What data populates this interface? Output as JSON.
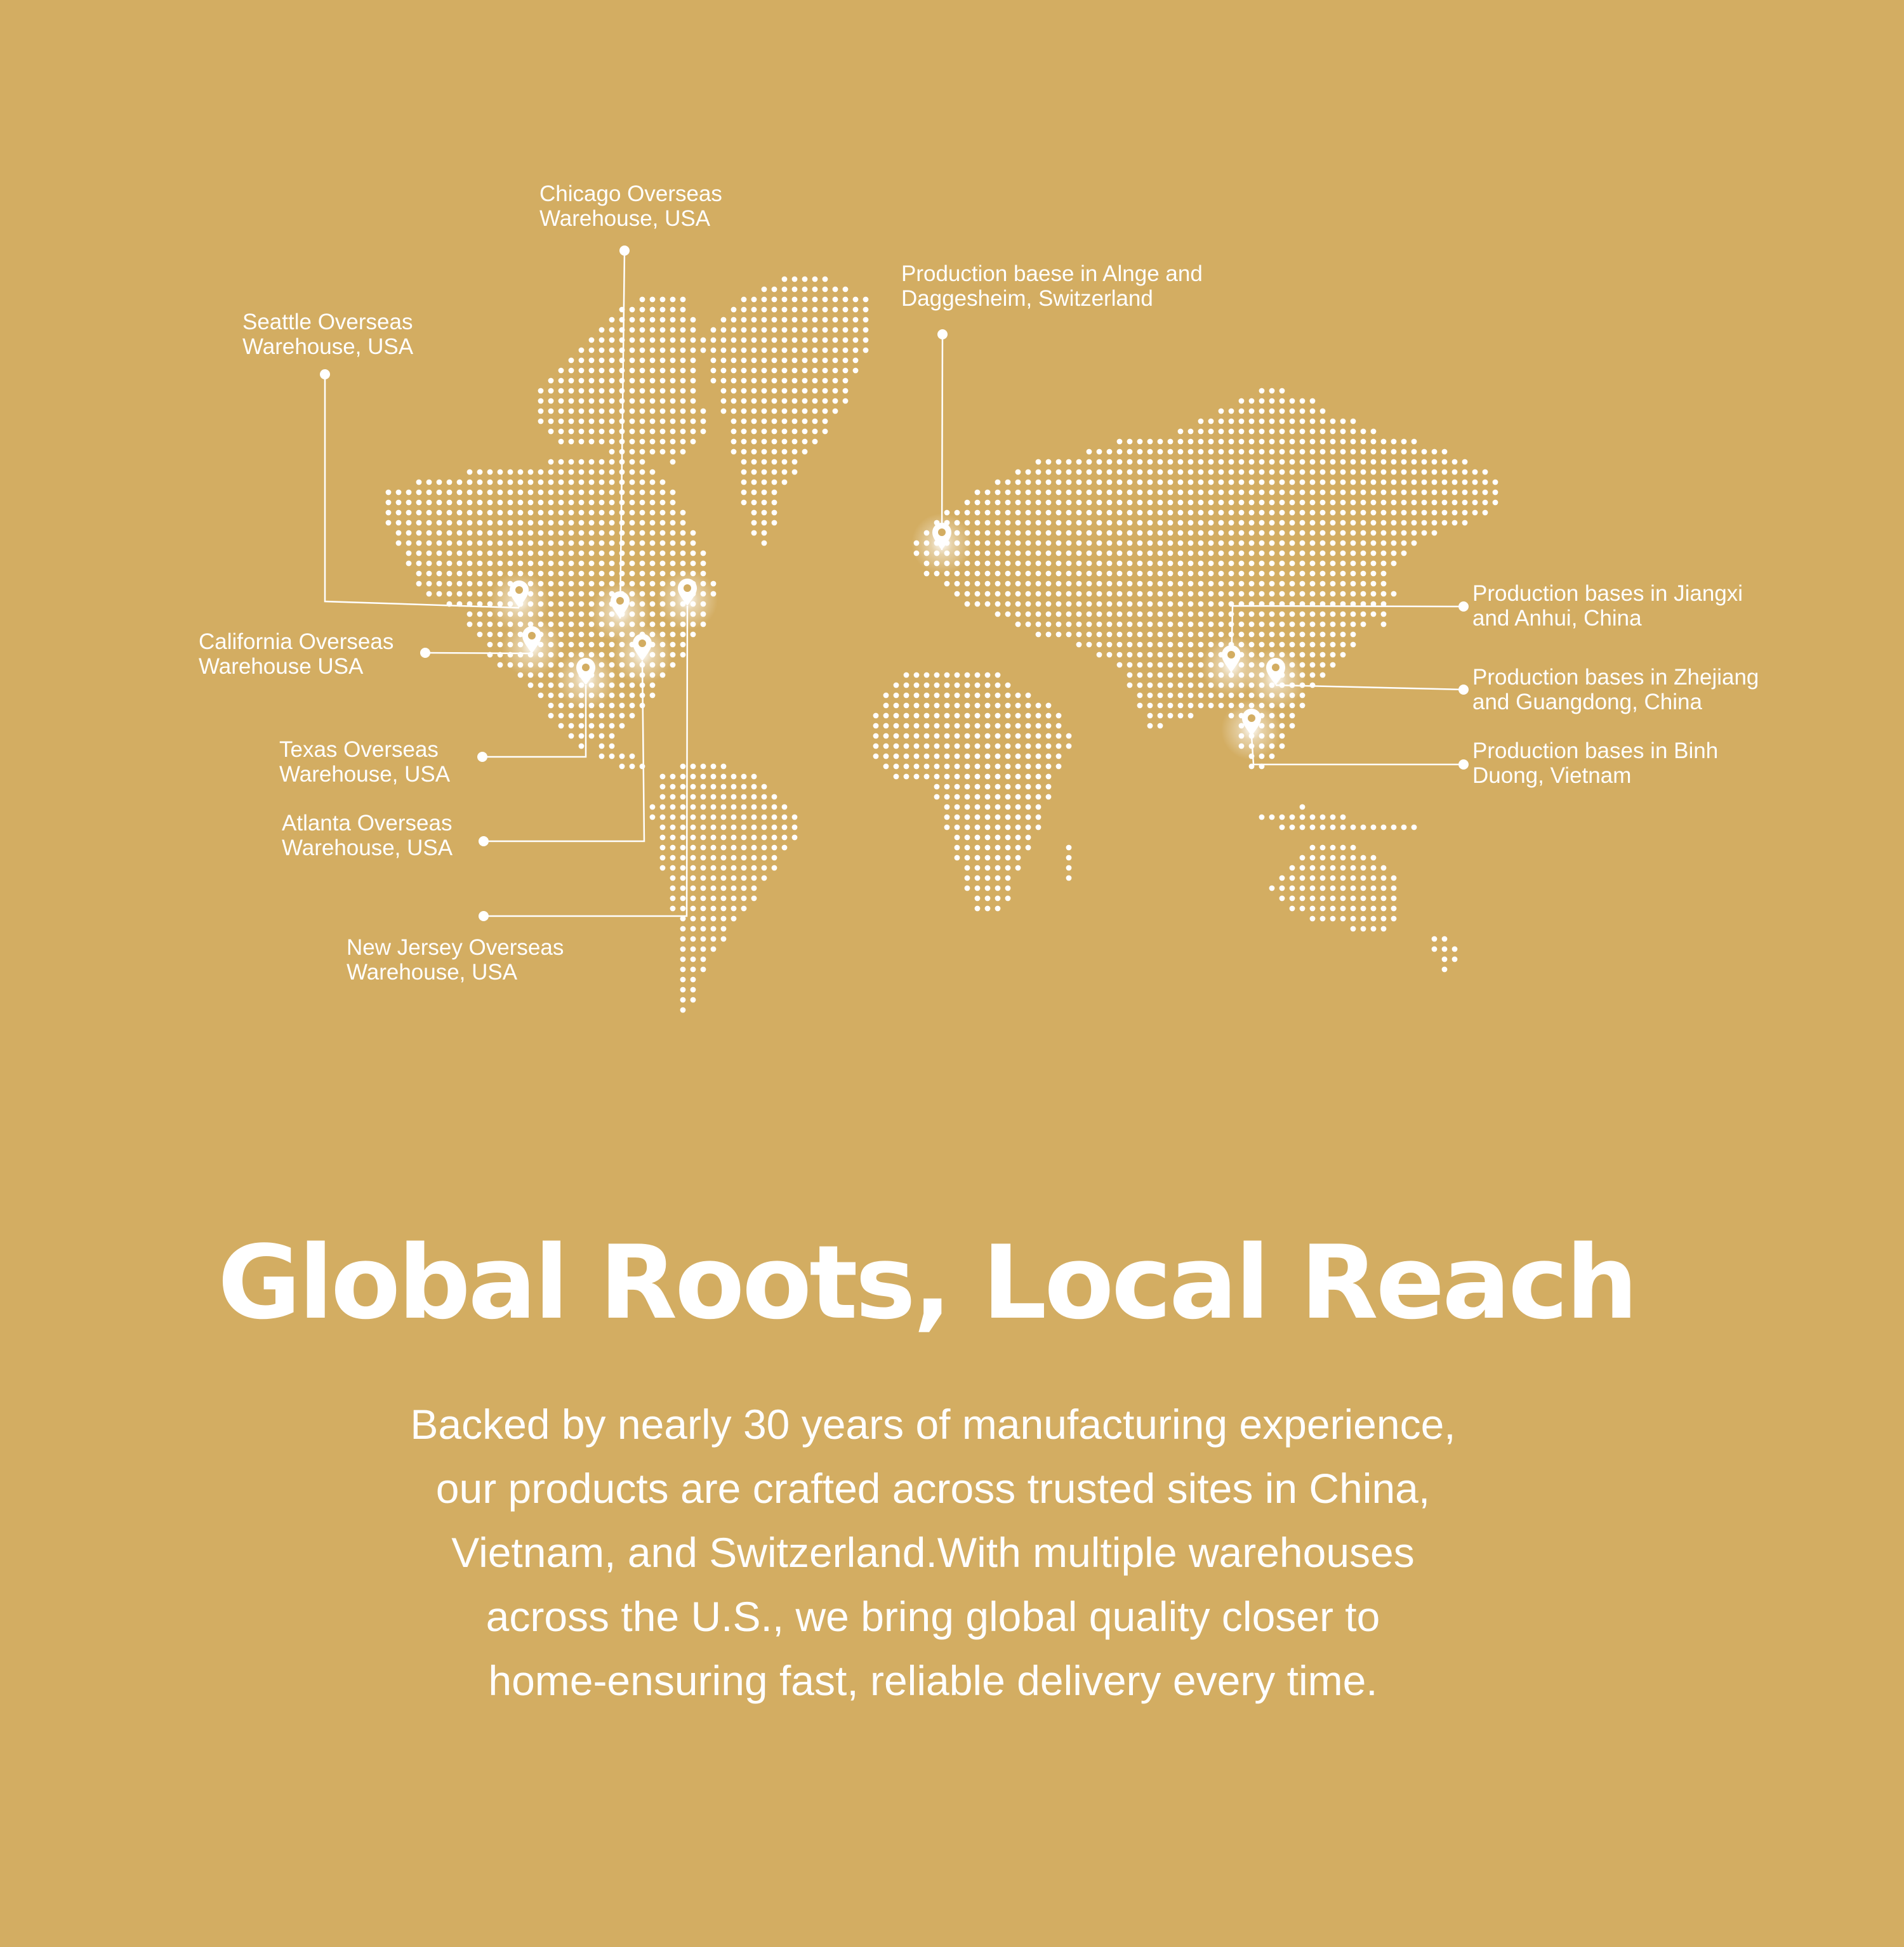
{
  "colors": {
    "background": "#D3AD62",
    "text": "#FFFFFF",
    "map_dots": "#FFFFFF",
    "pin": "#FFFFFF"
  },
  "map": {
    "icon": "map-pin-icon",
    "locations": [
      {
        "id": "chicago",
        "label": "Chicago Overseas\nWarehouse, USA"
      },
      {
        "id": "seattle",
        "label": "Seattle Overseas\nWarehouse, USA"
      },
      {
        "id": "california",
        "label": "California Overseas\nWarehouse USA"
      },
      {
        "id": "texas",
        "label": "Texas Overseas\nWarehouse, USA"
      },
      {
        "id": "atlanta",
        "label": "Atlanta Overseas\nWarehouse, USA"
      },
      {
        "id": "new-jersey",
        "label": "New Jersey Overseas\nWarehouse, USA"
      },
      {
        "id": "switzerland",
        "label": "Production baese in Alnge and\nDaggesheim, Switzerland"
      },
      {
        "id": "jiangxi",
        "label": "Production bases in Jiangxi\nand Anhui, China"
      },
      {
        "id": "zhejiang",
        "label": "Production bases in Zhejiang\nand Guangdong, China"
      },
      {
        "id": "vietnam",
        "label": "Production bases in Binh\nDuong, Vietnam"
      }
    ]
  },
  "headline": "Global Roots, Local Reach",
  "body": {
    "lines": [
      "Backed by nearly 30 years of manufacturing experience,",
      "our products are crafted across trusted sites in China,",
      "Vietnam, and Switzerland.With multiple warehouses",
      "across the U.S., we bring global quality closer to",
      "home-ensuring fast, reliable delivery every time."
    ]
  }
}
